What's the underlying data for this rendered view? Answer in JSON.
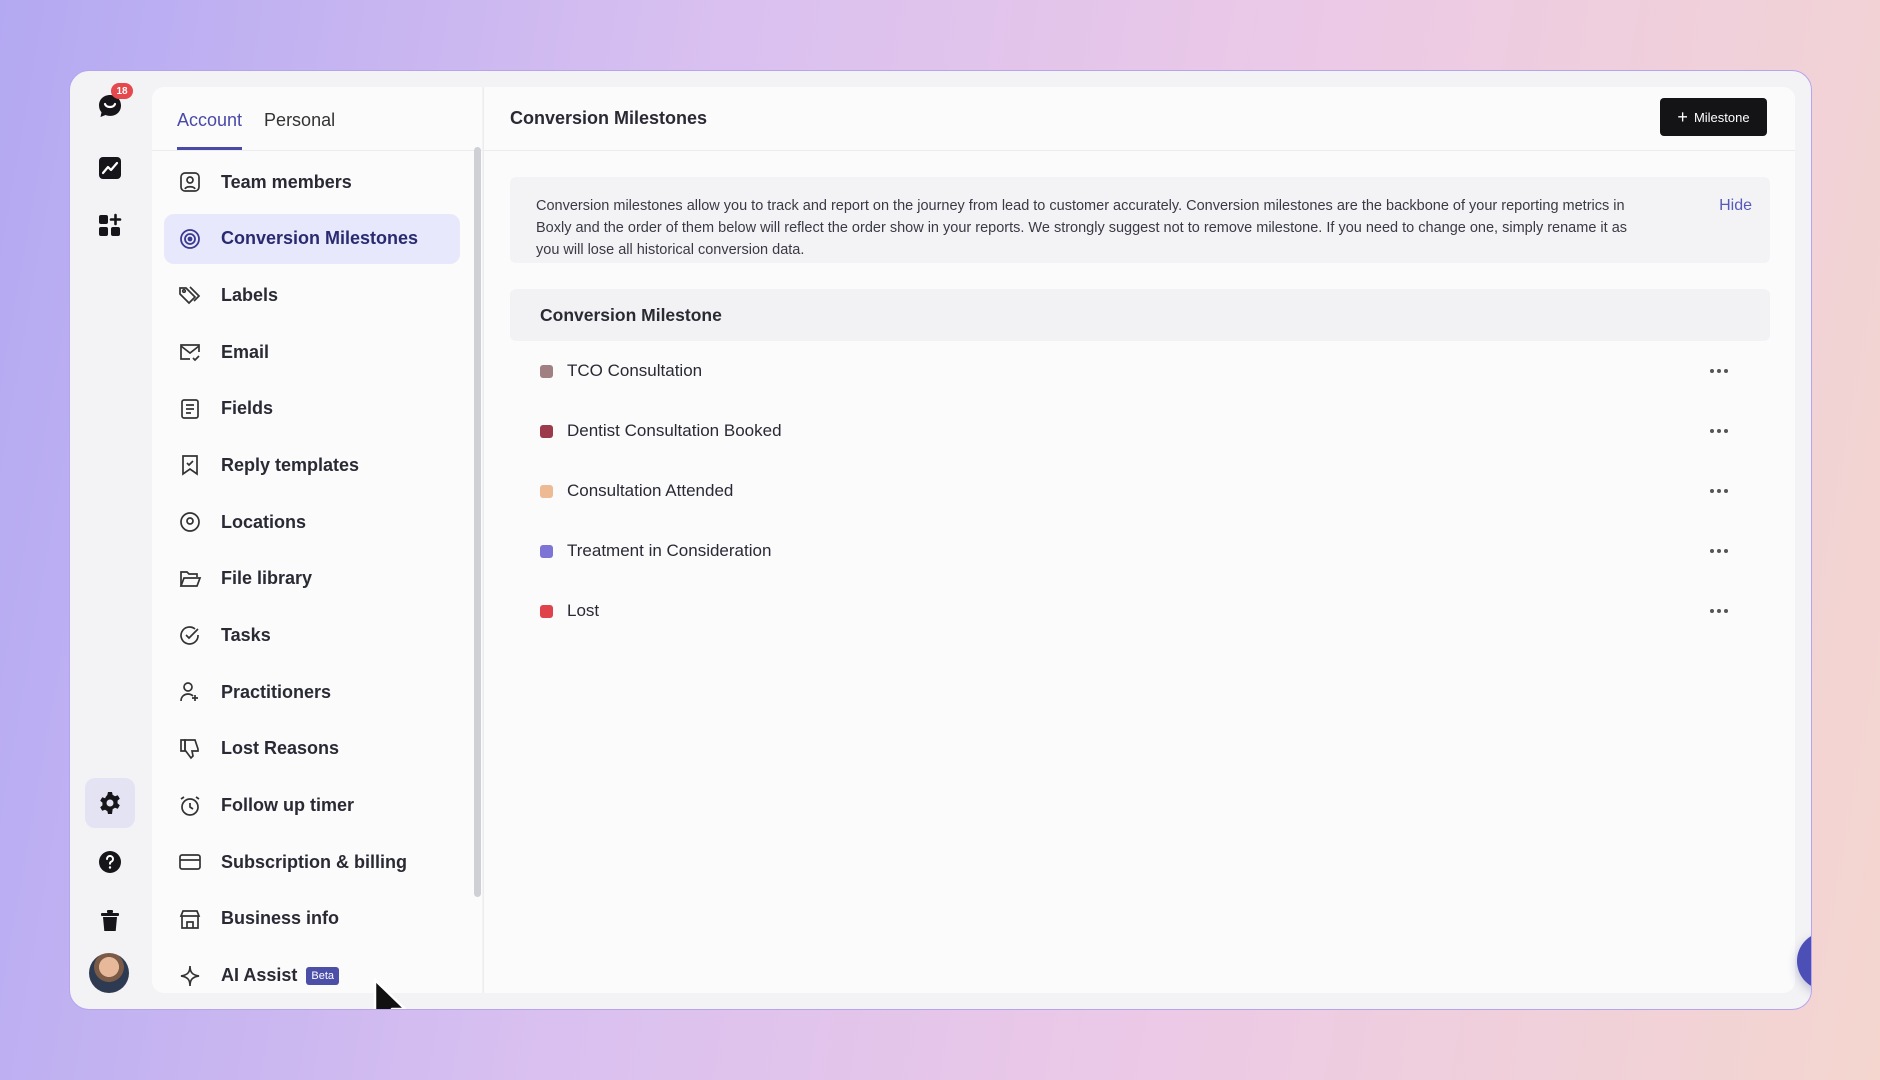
{
  "rail": {
    "notification_count": "18",
    "icons": [
      "logo-chat-icon",
      "analytics-icon",
      "apps-grid-icon",
      "settings-gear-icon",
      "help-icon",
      "trash-icon",
      "avatar"
    ]
  },
  "settings": {
    "tabs": [
      {
        "label": "Account",
        "active": true
      },
      {
        "label": "Personal",
        "active": false
      }
    ],
    "menu": [
      {
        "label": "Team members",
        "icon": "user-square-icon"
      },
      {
        "label": "Conversion Milestones",
        "icon": "target-icon",
        "active": true
      },
      {
        "label": "Labels",
        "icon": "tags-icon"
      },
      {
        "label": "Email",
        "icon": "mail-check-icon"
      },
      {
        "label": "Fields",
        "icon": "form-fields-icon"
      },
      {
        "label": "Reply templates",
        "icon": "bookmark-check-icon"
      },
      {
        "label": "Locations",
        "icon": "location-pin-icon"
      },
      {
        "label": "File library",
        "icon": "folder-open-icon"
      },
      {
        "label": "Tasks",
        "icon": "check-circle-icon"
      },
      {
        "label": "Practitioners",
        "icon": "practitioner-icon"
      },
      {
        "label": "Lost Reasons",
        "icon": "thumbs-down-icon"
      },
      {
        "label": "Follow up timer",
        "icon": "alarm-clock-icon"
      },
      {
        "label": "Subscription & billing",
        "icon": "credit-card-icon"
      },
      {
        "label": "Business info",
        "icon": "store-icon"
      },
      {
        "label": "AI Assist",
        "icon": "sparkle-icon",
        "badge": "Beta"
      }
    ]
  },
  "main": {
    "title": "Conversion Milestones",
    "add_button": "Milestone",
    "info_text": "Conversion milestones allow you to track and report on the journey from lead to customer accurately. Conversion milestones are the backbone of your reporting metrics in Boxly and the order of them below will reflect the order show in your reports. We strongly suggest not to remove milestone. If you need to change one, simply rename it as you will lose all historical conversion data.",
    "hide_label": "Hide",
    "table_header": "Conversion Milestone",
    "milestones": [
      {
        "label": "TCO Consultation",
        "color": "#a08083"
      },
      {
        "label": "Dentist Consultation Booked",
        "color": "#9c3a4b"
      },
      {
        "label": "Consultation Attended",
        "color": "#edba94"
      },
      {
        "label": "Treatment in Consideration",
        "color": "#7d74d6"
      },
      {
        "label": "Lost",
        "color": "#e0424b"
      }
    ]
  },
  "colors": {
    "accent": "#4949a8",
    "active_menu_bg": "#e7e8fb",
    "button_dark": "#141417",
    "chat_fab": "#4b4fb6"
  }
}
